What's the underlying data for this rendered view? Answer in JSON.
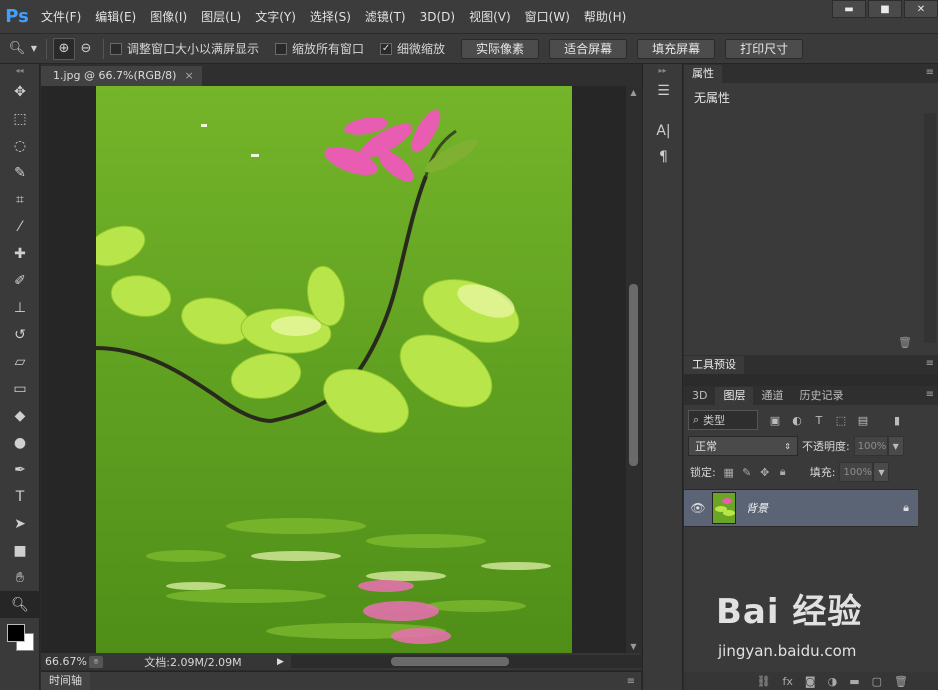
{
  "app": {
    "logo": "Ps"
  },
  "menu": [
    "文件(F)",
    "编辑(E)",
    "图像(I)",
    "图层(L)",
    "文字(Y)",
    "选择(S)",
    "滤镜(T)",
    "3D(D)",
    "视图(V)",
    "窗口(W)",
    "帮助(H)"
  ],
  "window_controls": {
    "minimize": "▬",
    "maximize": "■",
    "close": "✕"
  },
  "options": {
    "checks": [
      {
        "label": "调整窗口大小以满屏显示",
        "checked": false
      },
      {
        "label": "缩放所有窗口",
        "checked": false
      },
      {
        "label": "细微缩放",
        "checked": true
      }
    ],
    "buttons": [
      "实际像素",
      "适合屏幕",
      "填充屏幕",
      "打印尺寸"
    ]
  },
  "document": {
    "tab_title": "1.jpg @ 66.7%(RGB/8)",
    "tab_close": "×",
    "zoom": "66.67%",
    "doc_info": "文档:2.09M/2.09M"
  },
  "timeline": {
    "label": "时间轴"
  },
  "properties": {
    "tab": "属性",
    "title": "无属性"
  },
  "tool_presets": {
    "tab": "工具预设"
  },
  "layers": {
    "tabs": [
      "3D",
      "图层",
      "通道",
      "历史记录"
    ],
    "active_tab": "图层",
    "filter_kind": "类型",
    "blend_mode": "正常",
    "opacity_label": "不透明度:",
    "opacity_value": "100%",
    "lock_label": "锁定:",
    "fill_label": "填充:",
    "fill_value": "100%",
    "items": [
      {
        "name": "背景",
        "locked": true,
        "visible": true
      }
    ]
  },
  "watermark": {
    "text": "Bai 经验",
    "url": "jingyan.baidu.com"
  },
  "colors": {
    "accent": "#3fa0ff",
    "selected_layer": "#5a6475",
    "canvas_green": "#6ba524"
  }
}
